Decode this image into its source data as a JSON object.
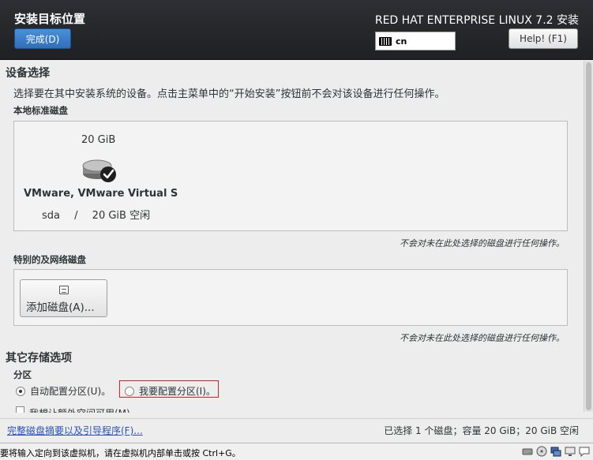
{
  "header": {
    "title": "安装目标位置",
    "done_label": "完成(D)",
    "product": "RED HAT ENTERPRISE LINUX 7.2 安装",
    "keyboard_value": "cn",
    "help_label": "Help! (F1)"
  },
  "device_selection": {
    "heading": "设备选择",
    "description": "选择要在其中安装系统的设备。点击主菜单中的“开始安装”按钮前不会对该设备进行任何操作。",
    "local_disks": {
      "heading": "本地标准磁盘",
      "disk": {
        "size": "20 GiB",
        "name": "VMware, VMware Virtual S",
        "device": "sda",
        "separator": "/",
        "free": "20 GiB 空闲"
      },
      "note": "不会对未在此处选择的磁盘进行任何操作。"
    },
    "special_disks": {
      "heading": "特别的及网络磁盘",
      "add_button_label": "添加磁盘(A)...",
      "note": "不会对未在此处选择的磁盘进行任何操作。"
    }
  },
  "other_storage": {
    "heading": "其它存储选项",
    "partition_heading": "分区",
    "auto_option": "自动配置分区(U)。",
    "manual_option": "我要配置分区(I)。",
    "extra_space_option": "我想让额外空间可用(M)。"
  },
  "footer": {
    "summary_link": "完整磁盘摘要以及引导程序(F)...",
    "summary_text": "已选择 1 个磁盘；容量 20 GiB；20 GiB 空闲"
  },
  "vm_status": {
    "message": "要将输入定向到该虚拟机，请在虚拟机内部单击或按 Ctrl+G。"
  }
}
